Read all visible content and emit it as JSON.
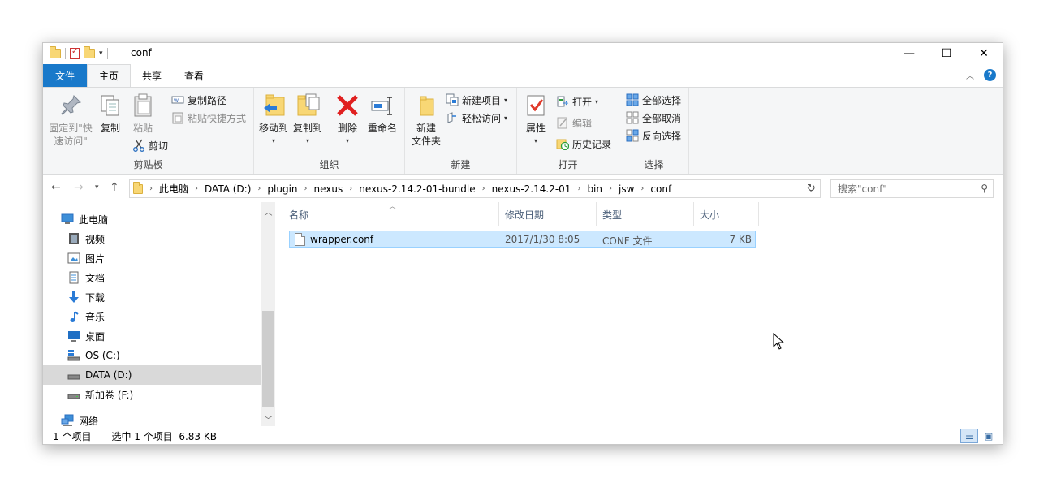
{
  "window": {
    "title": "conf"
  },
  "window_controls": {
    "minimize": "—",
    "maximize": "☐",
    "close": "✕"
  },
  "ribbon_tabs": [
    {
      "label": "文件"
    },
    {
      "label": "主页"
    },
    {
      "label": "共享"
    },
    {
      "label": "查看"
    }
  ],
  "ribbon": {
    "clipboard": {
      "label": "剪贴板",
      "pin": "固定到\"快\n速访问\"",
      "copy": "复制",
      "paste": "粘贴",
      "copy_path": "复制路径",
      "paste_shortcut": "粘贴快捷方式",
      "cut": "剪切"
    },
    "organize": {
      "label": "组织",
      "move_to": "移动到",
      "copy_to": "复制到",
      "delete": "删除",
      "rename": "重命名"
    },
    "new": {
      "label": "新建",
      "new_folder": "新建\n文件夹",
      "new_item": "新建项目",
      "easy_access": "轻松访问"
    },
    "open": {
      "label": "打开",
      "properties": "属性",
      "open": "打开",
      "edit": "编辑",
      "history": "历史记录"
    },
    "select": {
      "label": "选择",
      "select_all": "全部选择",
      "select_none": "全部取消",
      "invert": "反向选择"
    }
  },
  "address": {
    "crumbs": [
      "此电脑",
      "DATA (D:)",
      "plugin",
      "nexus",
      "nexus-2.14.2-01-bundle",
      "nexus-2.14.2-01",
      "bin",
      "jsw",
      "conf"
    ],
    "search_placeholder": "搜索\"conf\""
  },
  "nav_pane": {
    "items": [
      {
        "label": "此电脑",
        "icon": "computer-icon"
      },
      {
        "label": "视频",
        "icon": "video-icon"
      },
      {
        "label": "图片",
        "icon": "pictures-icon"
      },
      {
        "label": "文档",
        "icon": "documents-icon"
      },
      {
        "label": "下载",
        "icon": "download-icon"
      },
      {
        "label": "音乐",
        "icon": "music-icon"
      },
      {
        "label": "桌面",
        "icon": "desktop-icon"
      },
      {
        "label": "OS (C:)",
        "icon": "drive-os-icon"
      },
      {
        "label": "DATA (D:)",
        "icon": "drive-icon",
        "selected": true
      },
      {
        "label": "新加卷 (F:)",
        "icon": "drive-icon"
      },
      {
        "label": "网络",
        "icon": "network-icon"
      }
    ]
  },
  "file_list": {
    "columns": [
      "名称",
      "修改日期",
      "类型",
      "大小"
    ],
    "rows": [
      {
        "name": "wrapper.conf",
        "modified": "2017/1/30 8:05",
        "type": "CONF 文件",
        "size": "7 KB"
      }
    ]
  },
  "status": {
    "count": "1 个项目",
    "selection": "选中 1 个项目  6.83 KB"
  }
}
